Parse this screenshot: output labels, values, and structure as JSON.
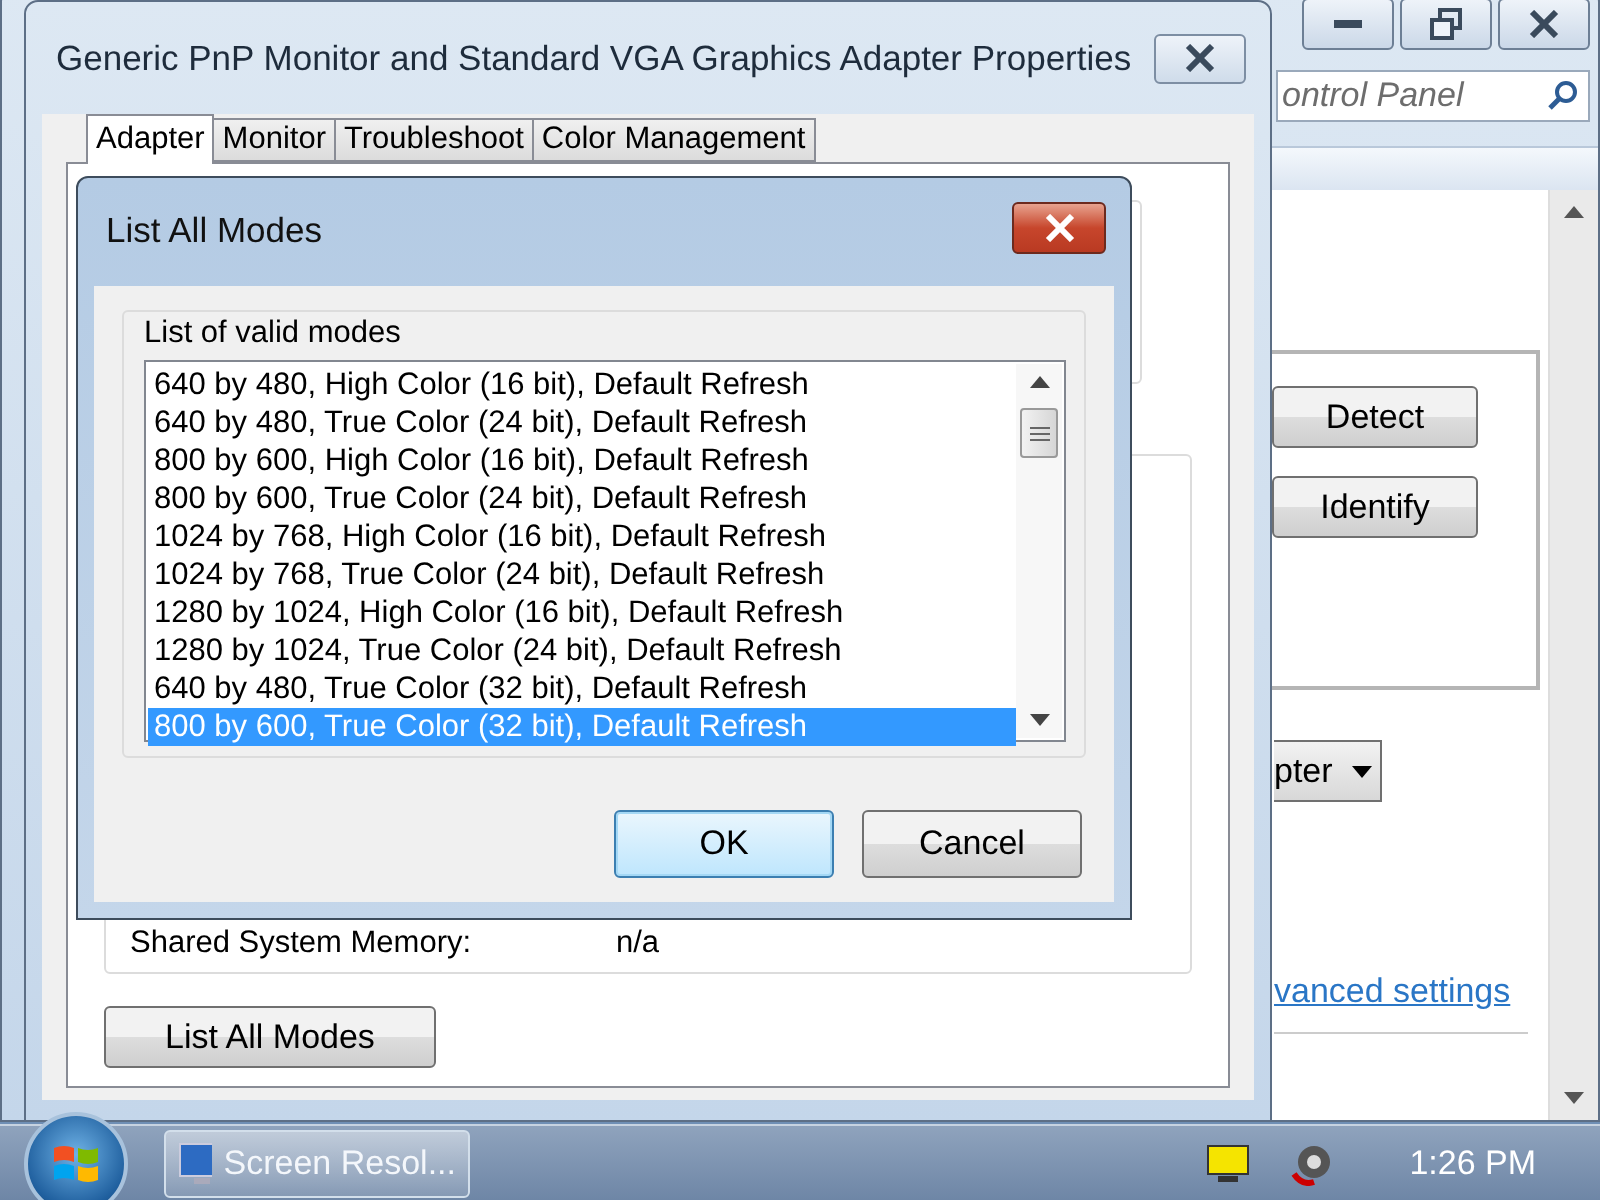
{
  "background_window": {
    "search": {
      "placeholder": "ontrol Panel"
    },
    "buttons": [
      "Detect",
      "Identify"
    ],
    "dropdown": "pter",
    "link": "vanced settings"
  },
  "properties_window": {
    "title": "Generic PnP Monitor and Standard VGA Graphics Adapter Properties",
    "tabs": [
      {
        "label": "Adapter",
        "selected": true
      },
      {
        "label": "Monitor",
        "selected": false
      },
      {
        "label": "Troubleshoot",
        "selected": false
      },
      {
        "label": "Color Management",
        "selected": false
      }
    ],
    "fields": [
      {
        "label": "Shared System Memory:",
        "value": "n/a"
      }
    ],
    "button": "List All Modes"
  },
  "dialog": {
    "title": "List All Modes",
    "group_label": "List of valid modes",
    "modes": [
      {
        "label": "640 by 480, High Color (16 bit), Default Refresh",
        "selected": false
      },
      {
        "label": "640 by 480, True Color (24 bit), Default Refresh",
        "selected": false
      },
      {
        "label": "800 by 600, High Color (16 bit), Default Refresh",
        "selected": false
      },
      {
        "label": "800 by 600, True Color (24 bit), Default Refresh",
        "selected": false
      },
      {
        "label": "1024 by 768, High Color (16 bit), Default Refresh",
        "selected": false
      },
      {
        "label": "1024 by 768, True Color (24 bit), Default Refresh",
        "selected": false
      },
      {
        "label": "1280 by 1024, High Color (16 bit), Default Refresh",
        "selected": false
      },
      {
        "label": "1280 by 1024, True Color (24 bit), Default Refresh",
        "selected": false
      },
      {
        "label": "640 by 480, True Color (32 bit), Default Refresh",
        "selected": false
      },
      {
        "label": "800 by 600, True Color (32 bit), Default Refresh",
        "selected": true
      }
    ],
    "buttons": [
      {
        "label": "OK",
        "default": true
      },
      {
        "label": "Cancel",
        "default": false
      }
    ]
  },
  "taskbar": {
    "tasks": [
      {
        "label": "Screen Resol..."
      }
    ],
    "clock": "1:26 PM"
  }
}
